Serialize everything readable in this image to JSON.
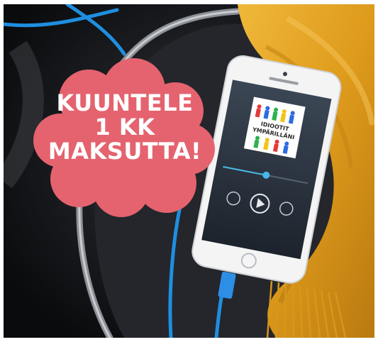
{
  "promo": {
    "line1": "KUUNTELE",
    "line2": "1 KK",
    "line3": "MAKSUTTA!"
  },
  "book": {
    "title_line1": "IDIOOTIT",
    "title_line2": "YMPÄRILLÄNI"
  },
  "colors": {
    "badge": "#e4636f",
    "cable": "#1e8fe0",
    "scarf": "#e0a11e",
    "seat": "#1a1c20"
  }
}
